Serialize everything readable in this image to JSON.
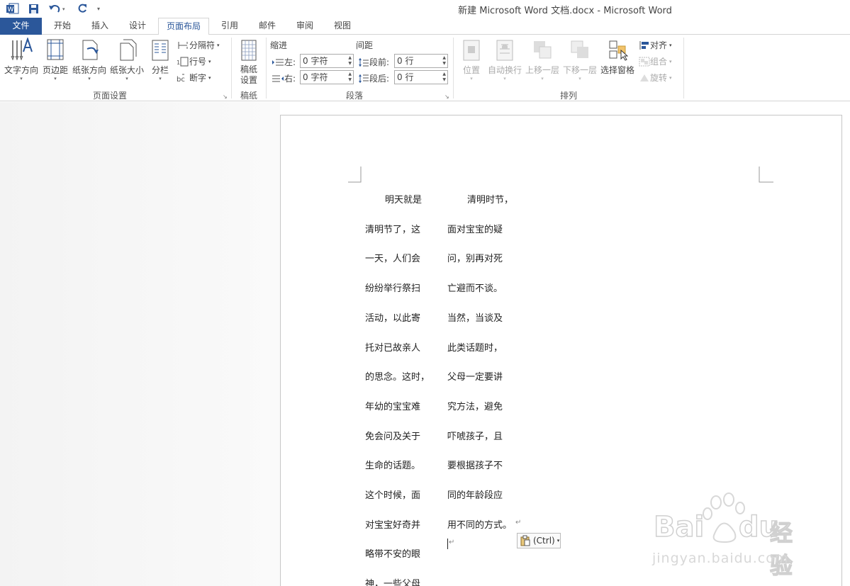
{
  "window": {
    "title": "新建 Microsoft Word 文档.docx - Microsoft Word"
  },
  "quick_access": {
    "icons": [
      "word-logo-icon",
      "save-icon",
      "undo-icon",
      "redo-icon",
      "customize-icon"
    ]
  },
  "tabs": [
    {
      "label": "文件"
    },
    {
      "label": "开始"
    },
    {
      "label": "插入"
    },
    {
      "label": "设计"
    },
    {
      "label": "页面布局"
    },
    {
      "label": "引用"
    },
    {
      "label": "邮件"
    },
    {
      "label": "审阅"
    },
    {
      "label": "视图"
    }
  ],
  "ribbon": {
    "page_setup": {
      "label": "页面设置",
      "text_direction": "文字方向",
      "margins": "页边距",
      "orientation": "纸张方向",
      "size": "纸张大小",
      "columns": "分栏",
      "breaks": "分隔符",
      "line_numbers": "行号",
      "hyphenation": "断字"
    },
    "manuscript": {
      "label": "稿纸",
      "button_line1": "稿纸",
      "button_line2": "设置"
    },
    "paragraph": {
      "label": "段落",
      "indent_header": "缩进",
      "spacing_header": "间距",
      "left_label": "左:",
      "right_label": "右:",
      "before_label": "段前:",
      "after_label": "段后:",
      "left_value": "0 字符",
      "right_value": "0 字符",
      "before_value": "0 行",
      "after_value": "0 行"
    },
    "arrange": {
      "label": "排列",
      "position": "位置",
      "wrap_text": "自动换行",
      "bring_forward": "上移一层",
      "send_backward": "下移一层",
      "selection_pane": "选择窗格",
      "align": "对齐",
      "group": "组合",
      "rotate": "旋转"
    }
  },
  "document": {
    "column_left": [
      "明天就是",
      "清明节了，这",
      "一天，人们会",
      "纷纷举行祭扫",
      "活动，以此寄",
      "托对已故亲人",
      "的思念。这时，",
      "年幼的宝宝难",
      "免会问及关于",
      "生命的话题。",
      "这个时候，面",
      "对宝宝好奇并",
      "略带不安的眼",
      "神，一些父母"
    ],
    "column_right": [
      "清明时节，",
      "面对宝宝的疑",
      "问，别再对死",
      "亡避而不谈。",
      "当然，当谈及",
      "此类话题时，",
      "父母一定要讲",
      "究方法，避免",
      "吓唬孩子，且",
      "要根据孩子不",
      "同的年龄段应",
      "用不同的方式。"
    ],
    "paste_options": "(Ctrl)"
  },
  "watermark": {
    "brand_1": "Bai",
    "brand_2": "du",
    "brand_cn": "经验",
    "url": "jingyan.baidu.com"
  },
  "colors": {
    "accent": "#2b579a"
  }
}
